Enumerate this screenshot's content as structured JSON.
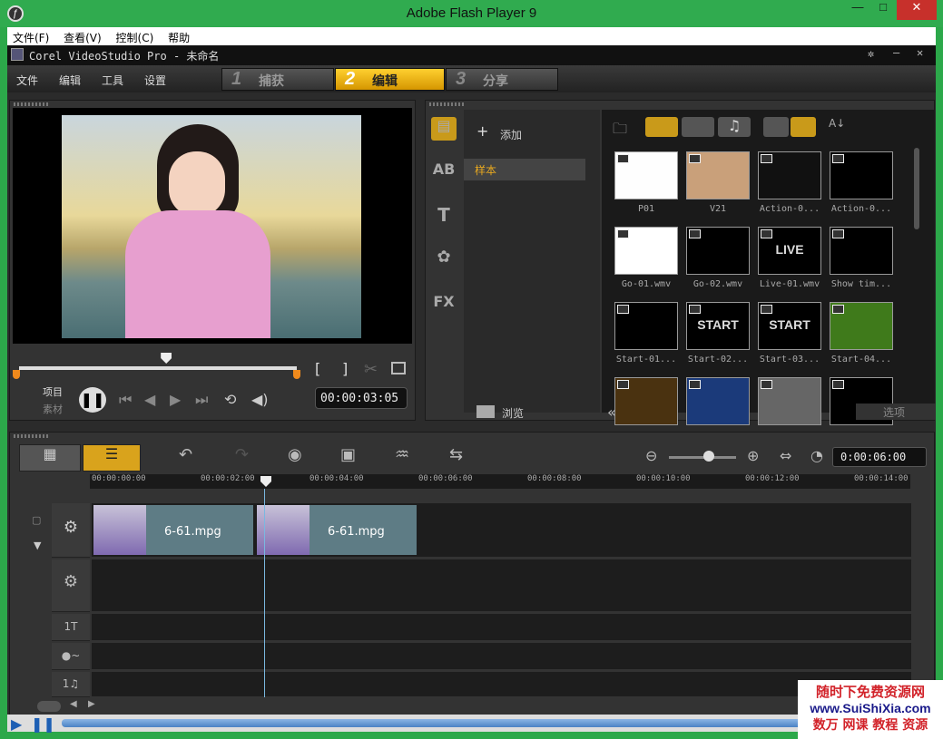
{
  "window": {
    "title": "Adobe Flash Player 9",
    "icon": "flash-player-icon",
    "min": "—",
    "max": "□",
    "close": "✕"
  },
  "menubar": [
    "文件(F)",
    "查看(V)",
    "控制(C)",
    "帮助"
  ],
  "app": {
    "title": "Corel VideoStudio Pro - 未命名",
    "menu": [
      "文件",
      "编辑",
      "工具",
      "设置"
    ],
    "steps": [
      {
        "num": "1",
        "label": "捕获"
      },
      {
        "num": "2",
        "label": "编辑"
      },
      {
        "num": "3",
        "label": "分享"
      }
    ],
    "active_step": 1
  },
  "player": {
    "mode_project": "项目",
    "mode_clip": "素材",
    "timecode": "00:00:03:05",
    "mark_in": "[",
    "mark_out": "]",
    "scrub_position": 0.53
  },
  "library": {
    "add_label": "添加",
    "folder": "样本",
    "browse_label": "浏览",
    "options_label": "选项",
    "sidebar": [
      "media-icon",
      "AB",
      "T",
      "filter-icon",
      "FX"
    ],
    "items": [
      {
        "label": "P01",
        "bg": "#fefefe"
      },
      {
        "label": "V21",
        "bg": "#c9a07a"
      },
      {
        "label": "Action-0...",
        "bg": "#111"
      },
      {
        "label": "Action-0...",
        "bg": "#000"
      },
      {
        "label": "Go-01.wmv",
        "bg": "#fff"
      },
      {
        "label": "Go-02.wmv",
        "bg": "#000"
      },
      {
        "label": "Live-01.wmv",
        "bg": "#000",
        "text": "LIVE"
      },
      {
        "label": "Show tim...",
        "bg": "#000"
      },
      {
        "label": "Start-01...",
        "bg": "#000"
      },
      {
        "label": "Start-02...",
        "bg": "#000",
        "text": "START"
      },
      {
        "label": "Start-03...",
        "bg": "#000",
        "text": "START"
      },
      {
        "label": "Start-04...",
        "bg": "#3f7a1b"
      },
      {
        "label": "",
        "bg": "#4a3210"
      },
      {
        "label": "",
        "bg": "#1b3a7a"
      },
      {
        "label": "",
        "bg": "#666"
      },
      {
        "label": "",
        "bg": "#000"
      }
    ]
  },
  "timeline": {
    "duration": "0:00:06:00",
    "ruler": [
      "00:00:00:00",
      "00:00:02:00",
      "00:00:04:00",
      "00:00:06:00",
      "00:00:08:00",
      "00:00:10:00",
      "00:00:12:00",
      "00:00:14:00"
    ],
    "clips": [
      {
        "label": "6-61.mpg"
      },
      {
        "label": "6-61.mpg"
      }
    ],
    "zoom_position": 0.6,
    "track_labels": [
      "1T",
      "1♫"
    ]
  },
  "watermark": {
    "line1": "随时下免费资源网",
    "line2": "www.SuiShiXia.com",
    "line3": "数万 网课 教程 资源"
  }
}
